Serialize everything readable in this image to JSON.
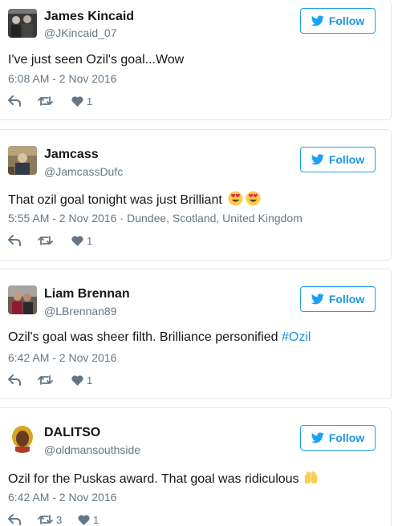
{
  "follow_label": "Follow",
  "colors": {
    "accent": "#1da1f2",
    "text": "#14171a",
    "secondary": "#657786",
    "border": "#e1e8ed"
  },
  "tweets": [
    {
      "name": "James Kincaid",
      "handle": "@JKincaid_07",
      "text": "I've just seen Ozil's goal...Wow",
      "time": "6:08 AM - 2 Nov 2016",
      "location": "",
      "retweets": "",
      "likes": "1"
    },
    {
      "name": "Jamcass",
      "handle": "@JamcassDufc",
      "text": "That ozil goal tonight was just Brilliant",
      "text_emoji": "heart-eyes-emoji x2",
      "time": "5:55 AM - 2 Nov 2016",
      "location": "Dundee, Scotland, United Kingdom",
      "retweets": "",
      "likes": "1"
    },
    {
      "name": "Liam Brennan",
      "handle": "@LBrennan89",
      "text": "Ozil's goal was sheer filth. Brilliance personified ",
      "hashtag": "#Ozil",
      "time": "6:42 AM - 2 Nov 2016",
      "location": "",
      "retweets": "",
      "likes": "1"
    },
    {
      "name": "DALITSO",
      "handle": "@oldmansouthside",
      "text": "Ozil for the Puskas award. That goal was ridiculous",
      "text_emoji": "raised-hands-emoji",
      "time": "6:42 AM - 2 Nov 2016",
      "location": "",
      "retweets": "3",
      "likes": "1"
    }
  ]
}
